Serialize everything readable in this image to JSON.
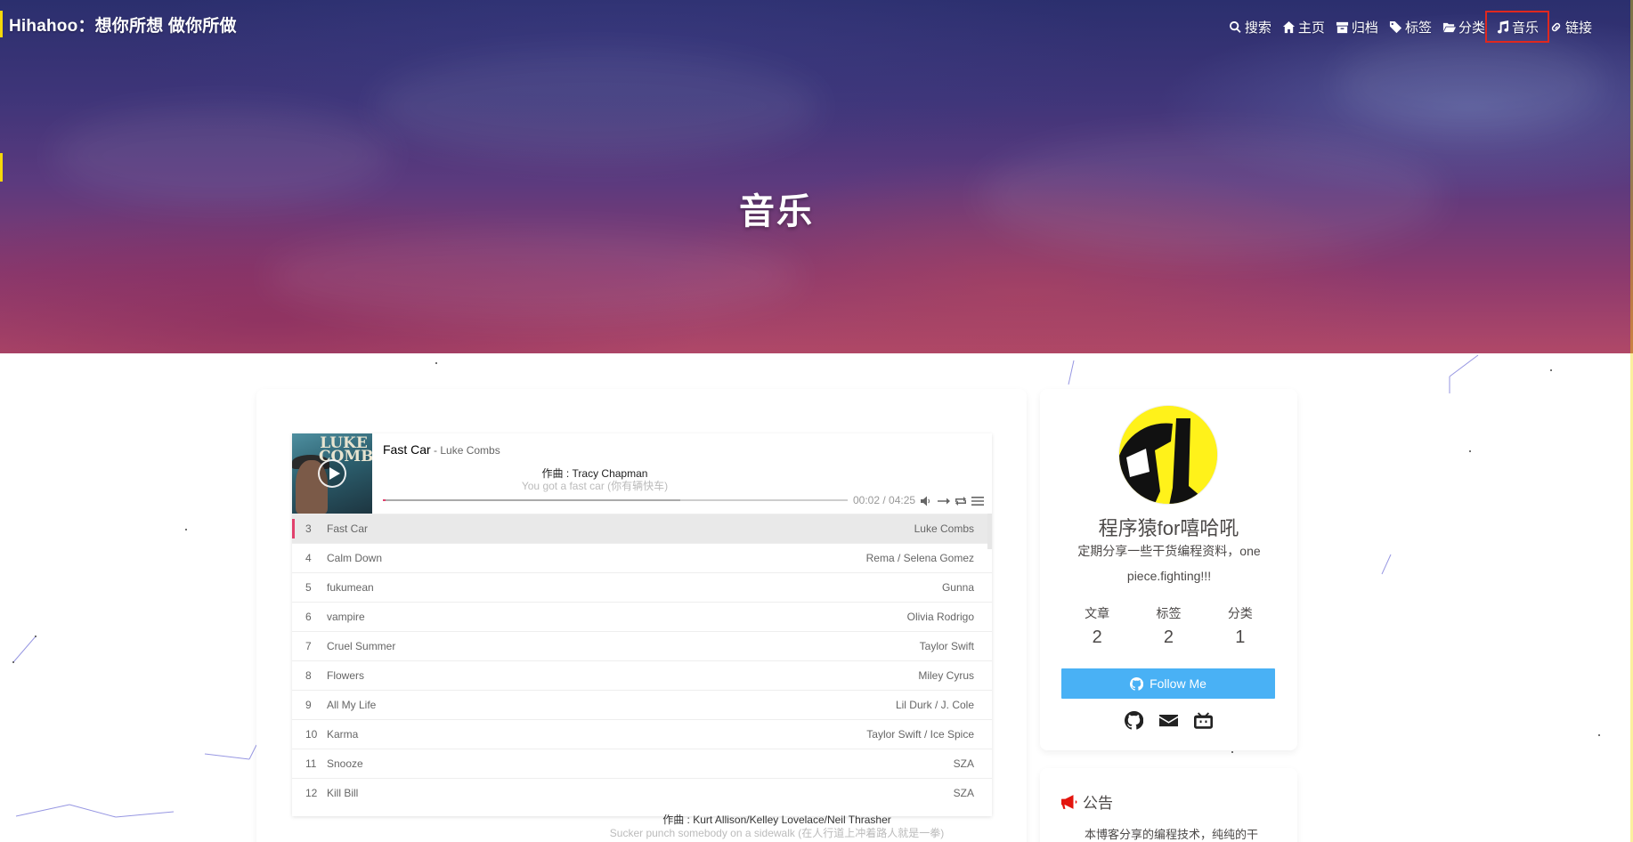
{
  "site": {
    "name": "Hihahoo：想你所想 做你所做"
  },
  "nav": [
    {
      "icon": "search-icon",
      "label": "搜索"
    },
    {
      "icon": "home-icon",
      "label": "主页"
    },
    {
      "icon": "archive-icon",
      "label": "归档"
    },
    {
      "icon": "tags-icon",
      "label": "标签"
    },
    {
      "icon": "folder-open-icon",
      "label": "分类"
    },
    {
      "icon": "music-icon",
      "label": "音乐",
      "active": true
    },
    {
      "icon": "link-icon",
      "label": "链接"
    }
  ],
  "page": {
    "title": "音乐"
  },
  "player": {
    "cover_text": "LUKE COMBS",
    "current_title": "Fast Car",
    "current_artist": " - Luke Combs",
    "lyric_current": "作曲 : Tracy Chapman",
    "lyric_next": "You got a fast car (你有辆快车)",
    "time": "00:02 / 04:25",
    "progress_played": 0.005,
    "progress_loaded": 0.64,
    "controls": [
      "volume-icon",
      "order-icon",
      "loop-icon",
      "playlist-icon"
    ],
    "playlist": [
      {
        "index": "3",
        "title": "Fast Car",
        "artist": "Luke Combs",
        "active": true
      },
      {
        "index": "4",
        "title": "Calm Down",
        "artist": "Rema / Selena Gomez"
      },
      {
        "index": "5",
        "title": "fukumean",
        "artist": "Gunna"
      },
      {
        "index": "6",
        "title": "vampire",
        "artist": "Olivia Rodrigo"
      },
      {
        "index": "7",
        "title": "Cruel Summer",
        "artist": "Taylor Swift"
      },
      {
        "index": "8",
        "title": "Flowers",
        "artist": "Miley Cyrus"
      },
      {
        "index": "9",
        "title": "All My Life",
        "artist": "Lil Durk / J. Cole"
      },
      {
        "index": "10",
        "title": "Karma",
        "artist": "Taylor Swift / Ice Spice"
      },
      {
        "index": "11",
        "title": "Snooze",
        "artist": "SZA"
      },
      {
        "index": "12",
        "title": "Kill Bill",
        "artist": "SZA"
      }
    ]
  },
  "footer_lyrics": {
    "line1": "作曲 : Kurt Allison/Kelley Lovelace/Neil Thrasher",
    "line2": "Sucker punch somebody on a sidewalk (在人行道上冲着路人就是一拳)"
  },
  "author": {
    "name": "程序猿for嘻哈吼",
    "description": "定期分享一些干货编程资料，one piece.fighting!!!",
    "stats": [
      {
        "label": "文章",
        "value": "2"
      },
      {
        "label": "标签",
        "value": "2"
      },
      {
        "label": "分类",
        "value": "1"
      }
    ],
    "follow_label": "Follow Me",
    "socials": [
      "github-icon",
      "envelope-icon",
      "bilibili-icon"
    ]
  },
  "notice": {
    "title": "公告",
    "text": "本博客分享的编程技术，纯纯的干"
  },
  "colors": {
    "accent": "#49b1f5",
    "player_accent": "#e1416d",
    "highlight_box": "#e0281e"
  }
}
